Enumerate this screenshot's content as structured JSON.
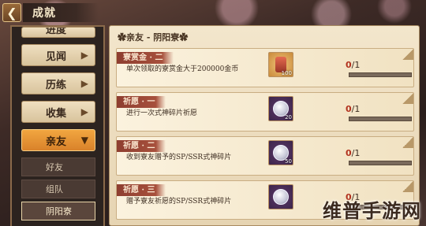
{
  "topbar": {
    "back_icon": "chevron-left-icon",
    "title": "成就"
  },
  "sidebar": {
    "items": [
      {
        "label": "进度",
        "state": "partial"
      },
      {
        "label": "见闻"
      },
      {
        "label": "历练"
      },
      {
        "label": "收集"
      },
      {
        "label": "亲友",
        "state": "expanded"
      }
    ],
    "sub_items": [
      {
        "label": "好友"
      },
      {
        "label": "组队"
      },
      {
        "label": "阴阳寮",
        "selected": true
      }
    ]
  },
  "main": {
    "section_title": "✿亲友 - 阴阳寮✿",
    "cards": [
      {
        "tag": "寮赏金 · 二",
        "desc": "单次领取的寮赏金大于200000金币",
        "reward_icon": "charm-icon",
        "reward_count": "100",
        "progress_current": "0",
        "progress_total": "/1",
        "fraction": 0
      },
      {
        "tag": "祈愿 · 一",
        "desc": "进行一次式神碎片祈愿",
        "reward_icon": "silver-coin-icon",
        "reward_count": "20",
        "progress_current": "0",
        "progress_total": "/1",
        "fraction": 0
      },
      {
        "tag": "祈愿 · 二",
        "desc": "收到寮友赠予的SP/SSR式神碎片",
        "reward_icon": "silver-coin-icon",
        "reward_count": "50",
        "progress_current": "0",
        "progress_total": "/1",
        "fraction": 0
      },
      {
        "tag": "祈愿 · 三",
        "desc": "赠予寮友祈愿的SP/SSR式神碎片",
        "reward_icon": "silver-coin-icon",
        "reward_count": "",
        "progress_current": "0",
        "progress_total": "/1",
        "fraction": 0
      }
    ]
  },
  "watermark": "维普手游网",
  "colors": {
    "accent_orange": "#e8952e",
    "tag_red": "#9a4634",
    "progress_red": "#b2321e"
  }
}
